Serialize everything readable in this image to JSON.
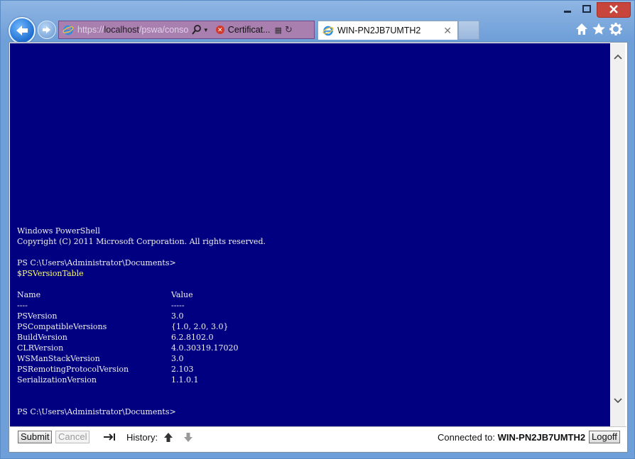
{
  "browser": {
    "url_protocol": "https://",
    "url_host": "localhost",
    "url_path": "/pswa/console.as",
    "certificate_label": "Certificat...",
    "tab_title": "WIN-PN2JB7UMTH2"
  },
  "console": {
    "lines": [
      {
        "text": "Windows PowerShell"
      },
      {
        "text": "Copyright (C) 2011 Microsoft Corporation. All rights reserved."
      },
      {
        "text": ""
      },
      {
        "text": "PS C:\\Users\\Administrator\\Documents>"
      },
      {
        "text": "$PSVersionTable",
        "color": "yellow"
      },
      {
        "text": ""
      },
      {
        "text": "Name",
        "value": "Value"
      },
      {
        "text": "----",
        "value": "-----"
      },
      {
        "text": "PSVersion",
        "value": "3.0"
      },
      {
        "text": "PSCompatibleVersions",
        "value": "{1.0, 2.0, 3.0}"
      },
      {
        "text": "BuildVersion",
        "value": "6.2.8102.0"
      },
      {
        "text": "CLRVersion",
        "value": "4.0.30319.17020"
      },
      {
        "text": "WSManStackVersion",
        "value": "3.0"
      },
      {
        "text": "PSRemotingProtocolVersion",
        "value": "2.103"
      },
      {
        "text": "SerializationVersion",
        "value": "1.1.0.1"
      },
      {
        "text": ""
      },
      {
        "text": ""
      },
      {
        "text": "PS C:\\Users\\Administrator\\Documents>"
      }
    ]
  },
  "bottom": {
    "submit_label": "Submit",
    "cancel_label": "Cancel",
    "history_label": "History:",
    "connected_label": "Connected to:",
    "connected_host": "WIN-PN2JB7UMTH2",
    "logoff_label": "Logoff"
  },
  "colors": {
    "console_bg": "#000080",
    "console_text": "#f0f0f0",
    "command_text": "#ffff66",
    "insecure_address_bar": "#a97fb0"
  }
}
